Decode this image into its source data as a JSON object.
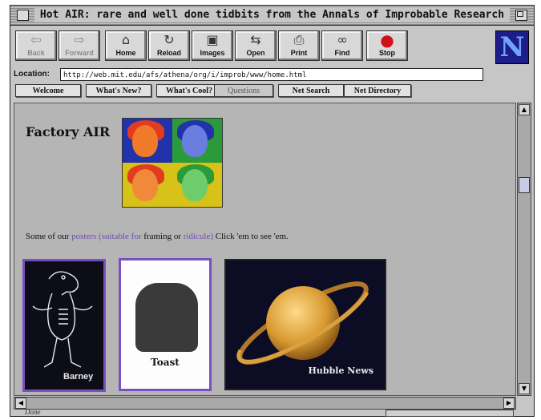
{
  "window": {
    "title": "Hot AIR: rare and well done tidbits from the Annals of Improbable Research"
  },
  "toolbar": {
    "buttons": [
      {
        "label": "Back",
        "icon": "back-arrow-icon",
        "glyph": "⇦",
        "enabled": false
      },
      {
        "label": "Forward",
        "icon": "forward-arrow-icon",
        "glyph": "⇨",
        "enabled": false
      },
      {
        "label": "Home",
        "icon": "home-icon",
        "glyph": "⌂",
        "enabled": true
      },
      {
        "label": "Reload",
        "icon": "reload-icon",
        "glyph": "↻",
        "enabled": true
      },
      {
        "label": "Images",
        "icon": "images-icon",
        "glyph": "▣",
        "enabled": true
      },
      {
        "label": "Open",
        "icon": "open-icon",
        "glyph": "⇆",
        "enabled": true
      },
      {
        "label": "Print",
        "icon": "print-icon",
        "glyph": "⎙",
        "enabled": true
      },
      {
        "label": "Find",
        "icon": "find-binoculars-icon",
        "glyph": "∞",
        "enabled": true
      },
      {
        "label": "Stop",
        "icon": "stop-icon",
        "glyph": "●",
        "enabled": true
      }
    ],
    "logo_letter": "N"
  },
  "location": {
    "label": "Location:",
    "url": "http://web.mit.edu/afs/athena/org/i/improb/www/home.html"
  },
  "directory_buttons": [
    "Welcome",
    "What's New?",
    "What's Cool?",
    "Questions",
    "Net Search",
    "Net Directory"
  ],
  "page": {
    "heading": "Factory AIR",
    "intro_prefix": "Some of our",
    "intro_link1": "posters (suitable for",
    "intro_mid": "framing or",
    "intro_link2": "ridicule)",
    "intro_suffix": "  Click 'em to see 'em.",
    "images": [
      {
        "caption": "Barney"
      },
      {
        "caption": "Toast"
      },
      {
        "caption": "Hubble News"
      }
    ]
  },
  "status": {
    "text": "Done"
  },
  "colors": {
    "chrome": "#c6c6c6",
    "content_bg": "#b5b5b5",
    "link": "#6e4fb0",
    "stop_red": "#d0101a",
    "popart": [
      "#e23b1f",
      "#2233aa",
      "#d8c21a",
      "#2a9a3a"
    ]
  }
}
